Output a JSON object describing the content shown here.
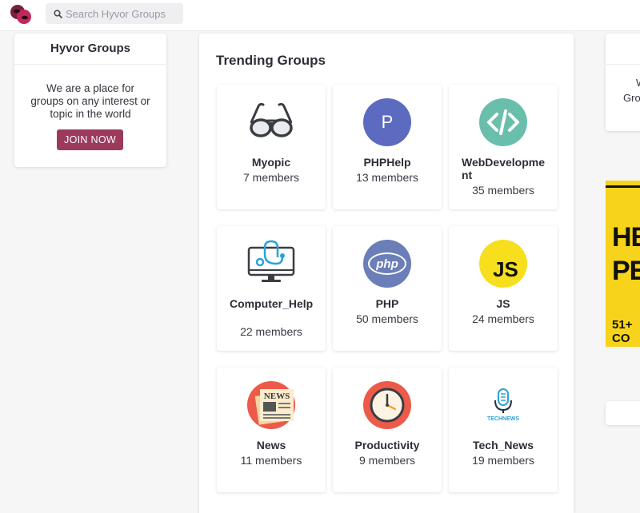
{
  "header": {
    "search_placeholder": "Search Hyvor Groups"
  },
  "sidebar": {
    "title": "Hyvor Groups",
    "description": "We are a place for groups on any interest or topic in the world",
    "join_label": "JOIN NOW",
    "join_color": "#9b3a5c"
  },
  "main": {
    "heading": "Trending Groups",
    "groups": [
      {
        "name": "Myopic",
        "members": "7 members",
        "icon": "glasses-icon"
      },
      {
        "name": "PHPHelp",
        "members": "13 members",
        "icon": "letter-p-avatar-icon"
      },
      {
        "name": "WebDevelopment",
        "members": "35 members",
        "icon": "code-icon"
      },
      {
        "name": "Computer_Help",
        "members": "22 members",
        "icon": "computer-stethoscope-icon"
      },
      {
        "name": "PHP",
        "members": "50 members",
        "icon": "php-logo-icon"
      },
      {
        "name": "JS",
        "members": "24 members",
        "icon": "js-logo-icon"
      },
      {
        "name": "News",
        "members": "11 members",
        "icon": "newspaper-icon"
      },
      {
        "name": "Productivity",
        "members": "9 members",
        "icon": "clock-icon"
      },
      {
        "name": "Tech_News",
        "members": "19 members",
        "icon": "tech-news-mic-icon"
      }
    ]
  },
  "right": {
    "card_text_1": "W",
    "card_text_2": "Gro",
    "ad_line_1": "HEA",
    "ad_line_2": "PER",
    "ad_line_3": "51+ CO"
  }
}
